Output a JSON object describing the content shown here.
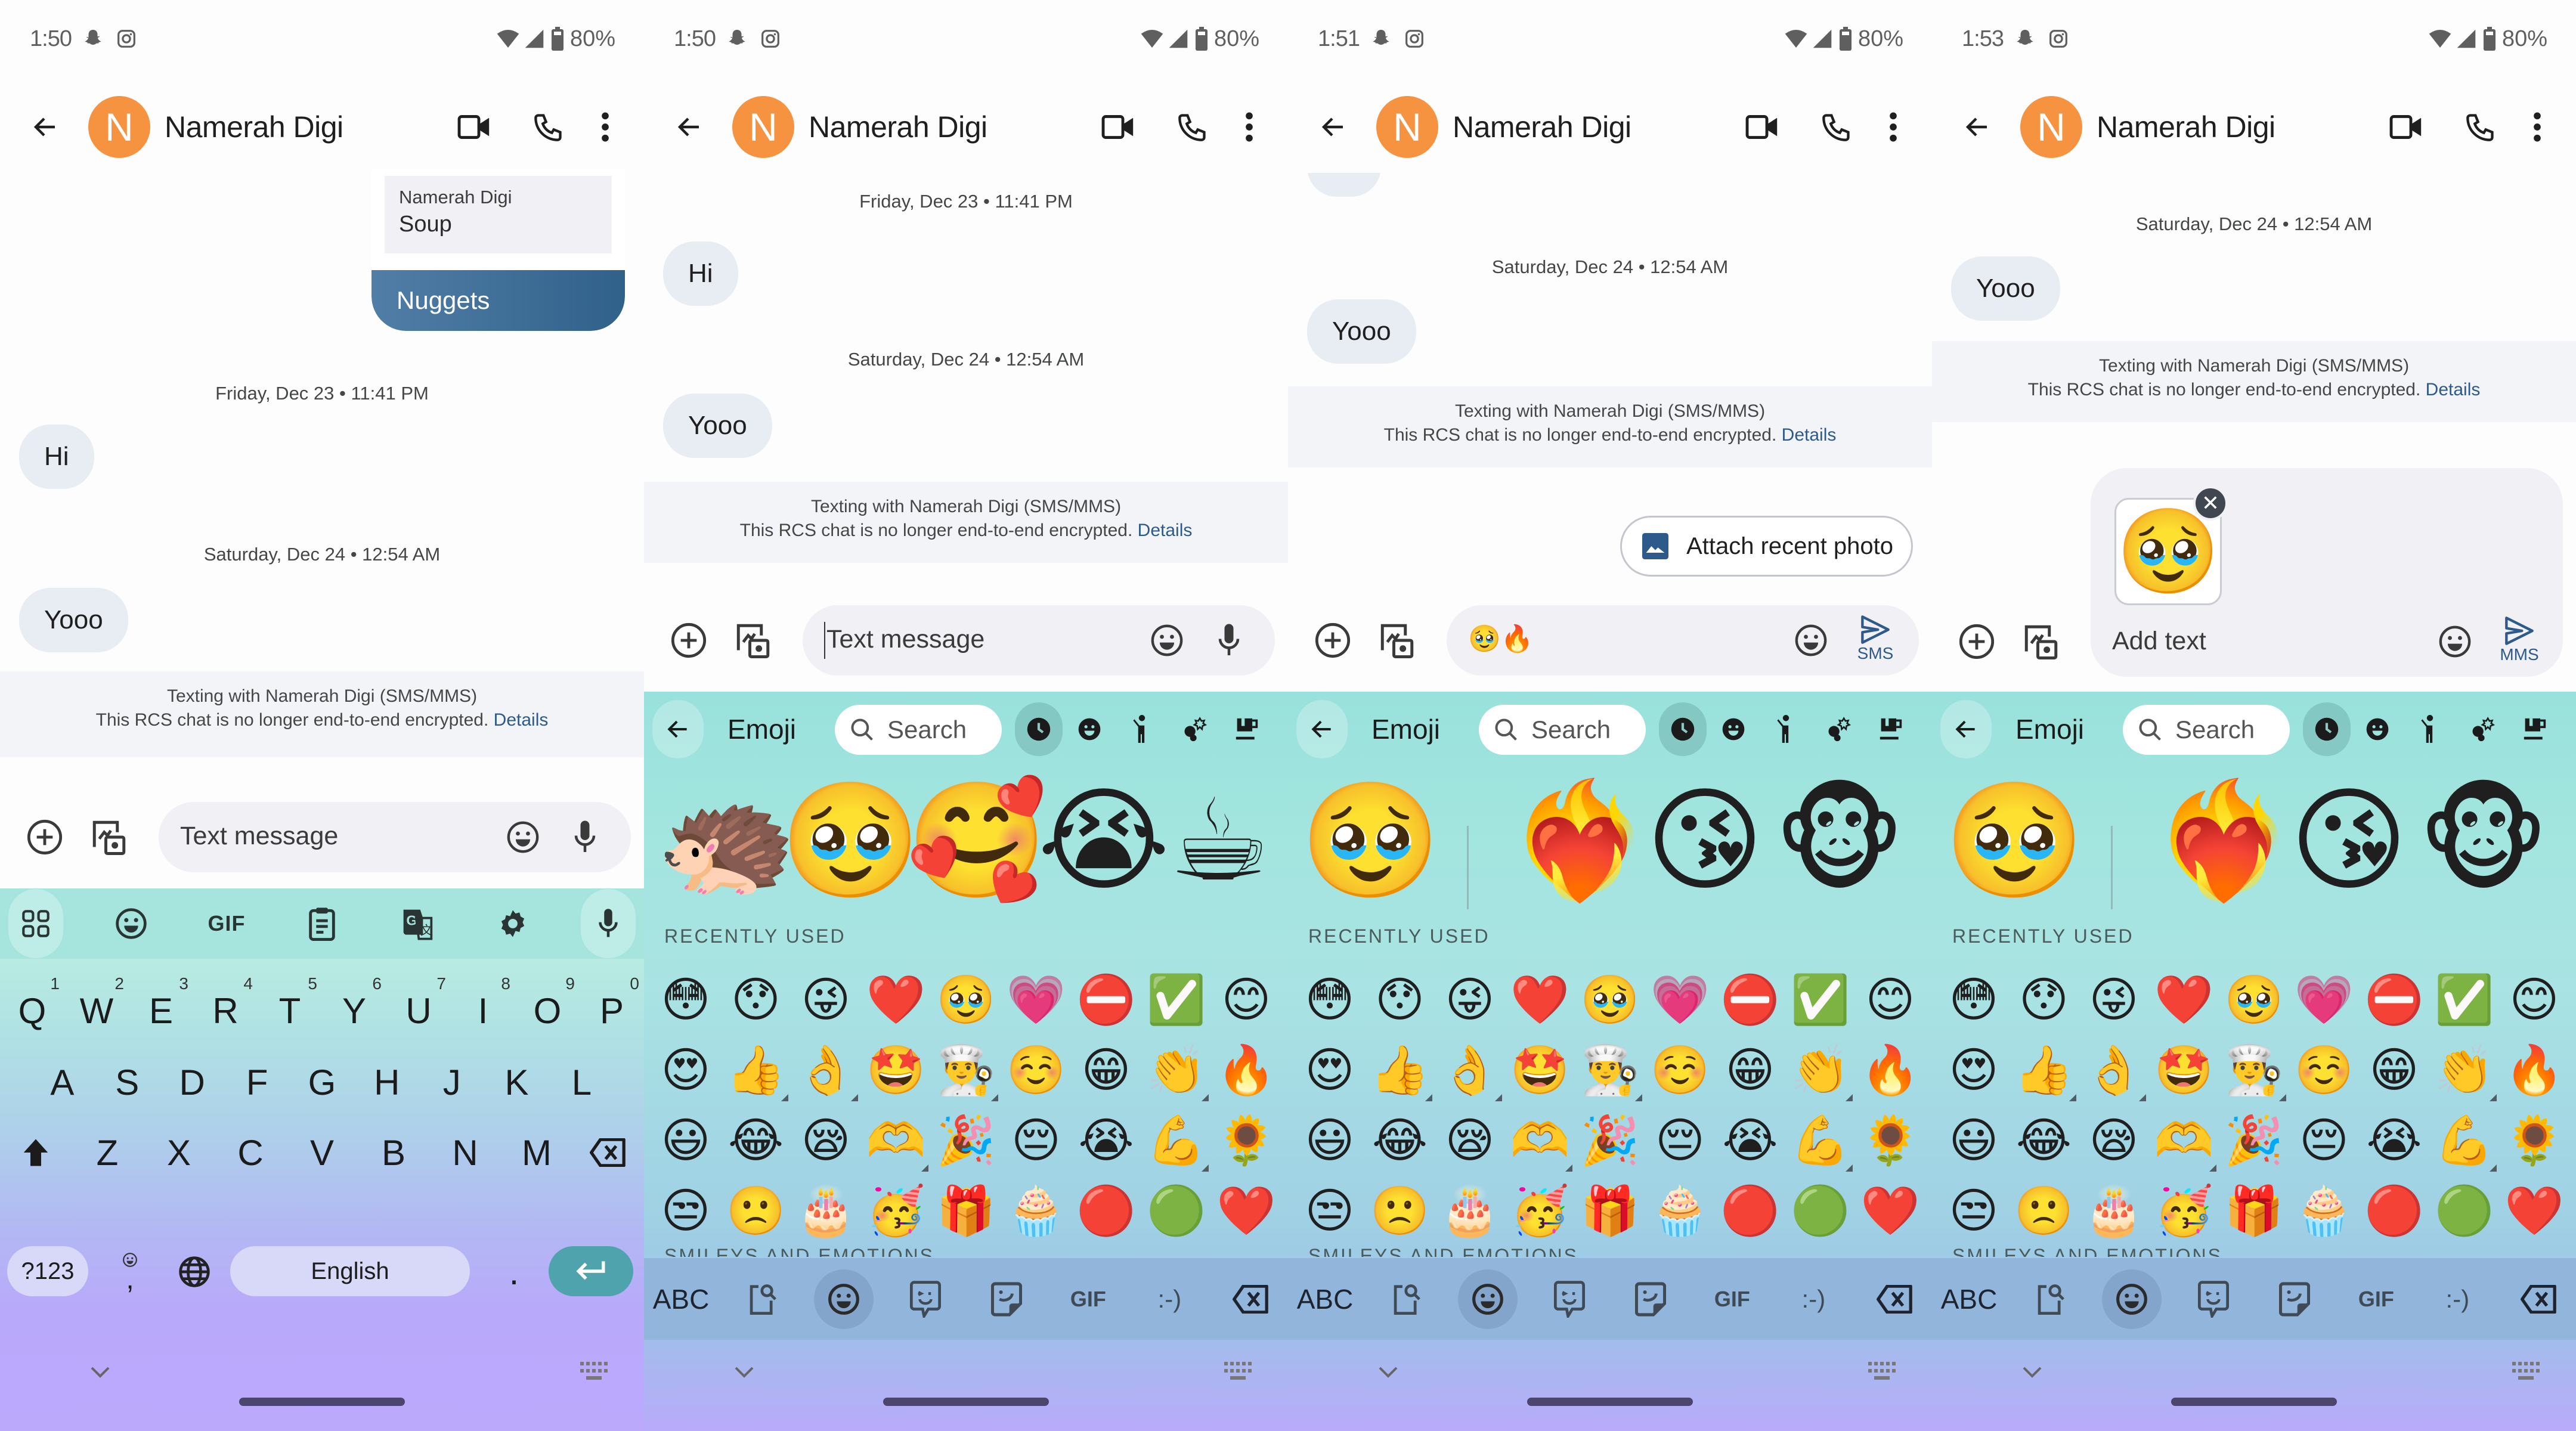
{
  "contact": {
    "name": "Namerah Digi",
    "initial": "N",
    "avatar_color": "#f59340"
  },
  "status_bar": {
    "battery": "80%",
    "icons": [
      "snapchat-icon",
      "instagram-icon",
      "wifi-icon",
      "signal-icon",
      "battery-icon"
    ]
  },
  "screens": [
    {
      "time": "1:50",
      "quoted": {
        "sender": "Namerah Digi",
        "text": "Soup",
        "reply": "Nuggets"
      },
      "date1": "Friday, Dec 23 • 11:41 PM",
      "msg1": "Hi",
      "date2": "Saturday, Dec 24 • 12:54 AM",
      "msg2": "Yooo",
      "compose_placeholder": "Text message"
    },
    {
      "time": "1:50",
      "date1": "Friday, Dec 23 • 11:41 PM",
      "msg1": "Hi",
      "date2": "Saturday, Dec 24 • 12:54 AM",
      "msg2": "Yooo",
      "compose_placeholder": "Text message"
    },
    {
      "time": "1:51",
      "date2": "Saturday, Dec 24 • 12:54 AM",
      "msg2": "Yooo",
      "attach_chip": "Attach recent photo",
      "compose_value": "🥹🔥",
      "send_label": "SMS"
    },
    {
      "time": "1:53",
      "date2": "Saturday, Dec 24 • 12:54 AM",
      "msg2": "Yooo",
      "compose_placeholder": "Add text",
      "attachment": "🥹",
      "send_label": "MMS"
    }
  ],
  "banner": {
    "line1": "Texting with Namerah Digi (SMS/MMS)",
    "line2": "This RCS chat is no longer end-to-end encrypted.",
    "link": "Details"
  },
  "keyboard": {
    "toolbar": [
      "apps-grid-icon",
      "emoji-icon",
      "GIF",
      "clipboard-icon",
      "translate-icon",
      "settings-gear-icon",
      "mic-icon"
    ],
    "gif_label": "GIF",
    "row1": [
      {
        "key": "Q",
        "num": "1"
      },
      {
        "key": "W",
        "num": "2"
      },
      {
        "key": "E",
        "num": "3"
      },
      {
        "key": "R",
        "num": "4"
      },
      {
        "key": "T",
        "num": "5"
      },
      {
        "key": "Y",
        "num": "6"
      },
      {
        "key": "U",
        "num": "7"
      },
      {
        "key": "I",
        "num": "8"
      },
      {
        "key": "O",
        "num": "9"
      },
      {
        "key": "P",
        "num": "0"
      }
    ],
    "row2": [
      "A",
      "S",
      "D",
      "F",
      "G",
      "H",
      "J",
      "K",
      "L"
    ],
    "row3": [
      "Z",
      "X",
      "C",
      "V",
      "B",
      "N",
      "M"
    ],
    "symbols_key": "?123",
    "comma_key": ",",
    "space_label": "English",
    "period_key": "."
  },
  "emoji_keyboard": {
    "title": "Emoji",
    "search_placeholder": "Search",
    "categories": [
      "recent-clock-icon",
      "smileys-icon",
      "people-icon",
      "animals-nature-icon",
      "food-drink-icon"
    ],
    "stickers_panel2": [
      "🦔",
      "🥹",
      "🥰",
      "😭",
      "☕"
    ],
    "stickers_mix": {
      "base": "🥹",
      "results": [
        "❤️‍🔥",
        "😘",
        "🐵"
      ]
    },
    "recently_used_label": "RECENTLY USED",
    "smileys_label": "SMILEYS AND EMOTIONS",
    "recent": [
      [
        "😳",
        "😯",
        "😜",
        "❤️",
        "🥹",
        "💗",
        "⛔",
        "✅",
        "😊"
      ],
      [
        "😍",
        "👍",
        "👌",
        "🤩",
        "👨‍🍳",
        "☺️",
        "😁",
        "👏",
        "🔥"
      ],
      [
        "😃",
        "😂",
        "😪",
        "🫶",
        "🎉",
        "😔",
        "😭",
        "💪",
        "🌻"
      ],
      [
        "😒",
        "🙁",
        "🎂",
        "🥳",
        "🎁",
        "🧁",
        "🔴",
        "🟢",
        "❤️"
      ]
    ],
    "variant_marks": [
      [
        1,
        1
      ],
      [
        1,
        2
      ],
      [
        1,
        4
      ],
      [
        1,
        7
      ],
      [
        2,
        3
      ],
      [
        2,
        7
      ]
    ],
    "bottom_bar": [
      "ABC",
      "sticker-search-icon",
      "emoji-icon",
      "bitmoji-icon",
      "sticker-icon",
      "GIF",
      ":-)",
      "backspace-icon"
    ],
    "abc_label": "ABC",
    "gif_label": "GIF",
    "emoticon_label": ":-)"
  }
}
